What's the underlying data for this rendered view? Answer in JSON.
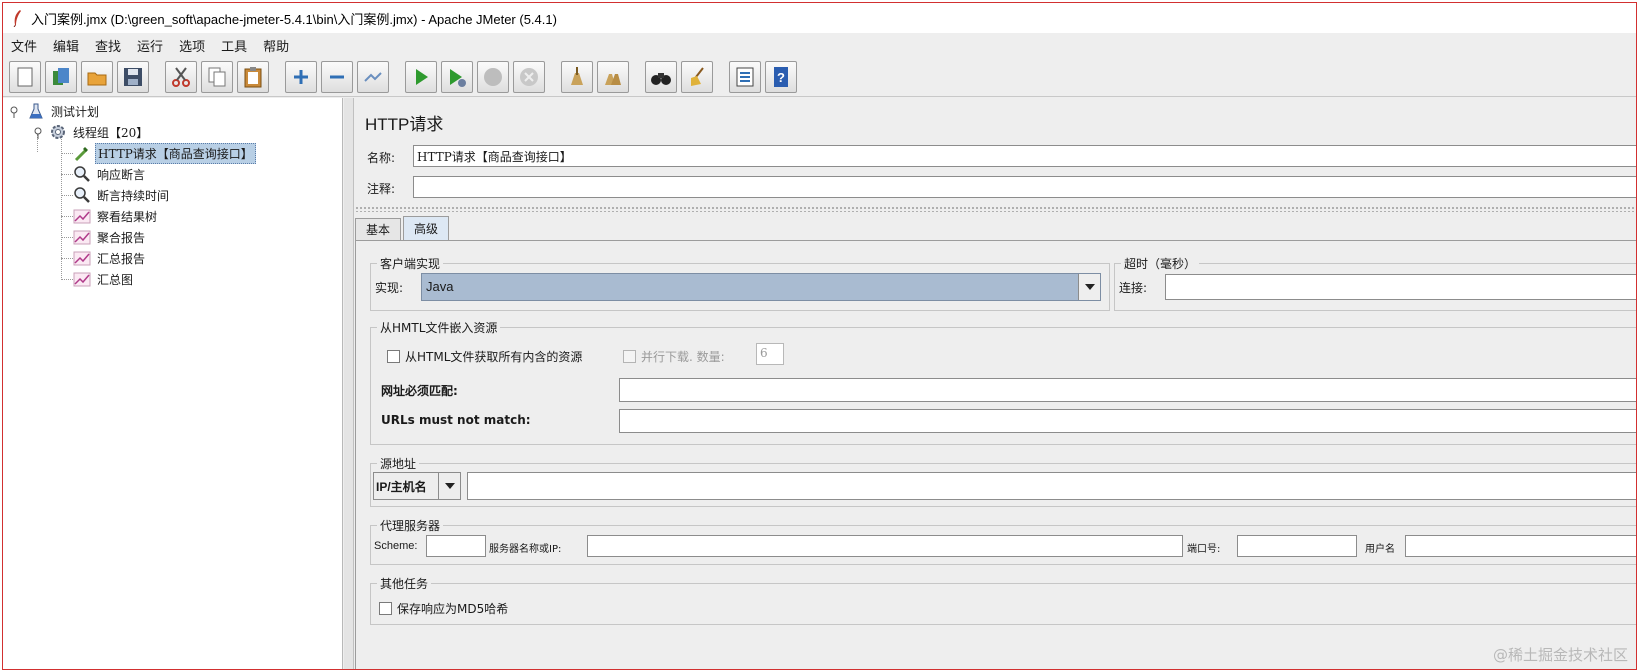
{
  "window": {
    "title": "入门案例.jmx (D:\\green_soft\\apache-jmeter-5.4.1\\bin\\入门案例.jmx) - Apache JMeter (5.4.1)"
  },
  "menu": [
    "文件",
    "编辑",
    "查找",
    "运行",
    "选项",
    "工具",
    "帮助"
  ],
  "toolbar": [
    "new-icon",
    "templates-icon",
    "open-icon",
    "save-icon",
    "cut-icon",
    "copy-icon",
    "paste-icon",
    "expand-icon",
    "collapse-icon",
    "toggle-icon",
    "start-icon",
    "start-no-pause-icon",
    "stop-icon",
    "shutdown-icon",
    "clear-icon",
    "clear-all-icon",
    "search-icon",
    "reset-search-icon",
    "function-helper-icon",
    "help-icon"
  ],
  "tree": {
    "nodes": [
      {
        "label": "测试计划"
      },
      {
        "label": "线程组【20】"
      },
      {
        "label": "HTTP请求【商品查询接口】"
      },
      {
        "label": "响应断言"
      },
      {
        "label": "断言持续时间"
      },
      {
        "label": "察看结果树"
      },
      {
        "label": "聚合报告"
      },
      {
        "label": "汇总报告"
      },
      {
        "label": "汇总图"
      }
    ]
  },
  "panel": {
    "title": "HTTP请求",
    "name_label": "名称:",
    "name_value": "HTTP请求【商品查询接口】",
    "comment_label": "注释:",
    "comment_value": "",
    "tabs": [
      "基本",
      "高级"
    ],
    "client_impl": {
      "title": "客户端实现",
      "impl_label": "实现:",
      "impl_value": "Java"
    },
    "timeout": {
      "title": "超时（毫秒）",
      "connect_label": "连接:",
      "connect_value": ""
    },
    "embedded": {
      "title": "从HMTL文件嵌入资源",
      "retrieve_label": "从HTML文件获取所有内含的资源",
      "parallel_label": "并行下载. 数量:",
      "parallel_value": "6",
      "must_match_label": "网址必须匹配:",
      "must_not_match_label": "URLs must not match:"
    },
    "source": {
      "title": "源地址",
      "type_value": "IP/主机名",
      "address_value": ""
    },
    "proxy": {
      "title": "代理服务器",
      "scheme_label": "Scheme:",
      "server_label": "服务器名称或IP:",
      "port_label": "端口号:",
      "user_label": "用户名"
    },
    "other": {
      "title": "其他任务",
      "md5_label": "保存响应为MD5哈希"
    }
  },
  "watermark": "@稀土掘金技术社区"
}
